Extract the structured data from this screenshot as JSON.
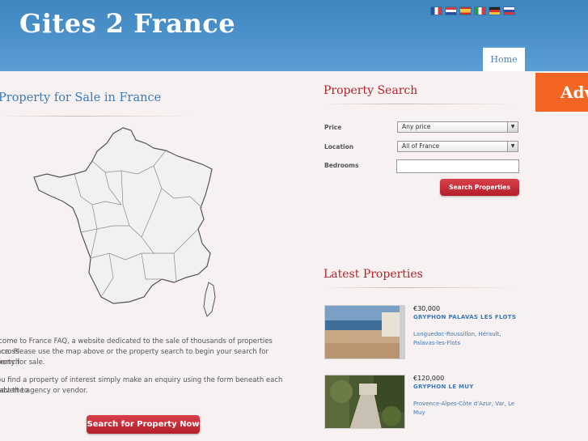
{
  "site": {
    "logo": "Gites 2 France"
  },
  "nav": {
    "home": "Home"
  },
  "banner": {
    "text": "Adv"
  },
  "flags": [
    "fr",
    "nl",
    "es",
    "it",
    "de",
    "ru"
  ],
  "main": {
    "title": "Property for Sale in France",
    "intro_1": "lcome to France FAQ, a website dedicated to the sale of thousands of properties across",
    "intro_2": "nce. Please use the map above or the property search to begin your search for French",
    "intro_3": "perty for sale.",
    "intro_4": "ou find a property of interest simply make an enquiry using the form beneath each advert to",
    "intro_5": "tact the agency or vendor.",
    "cta": "Search for Property Now"
  },
  "search": {
    "title": "Property Search",
    "price_label": "Price",
    "price_value": "Any price",
    "location_label": "Location",
    "location_value": "All of France",
    "bedrooms_label": "Bedrooms",
    "bedrooms_value": "",
    "submit": "Search Properties"
  },
  "latest": {
    "title": "Latest Properties",
    "items": [
      {
        "price": "€30,000",
        "name": "GRYPHON PALAVAS LES FLOTS",
        "location": "Languedoc-Roussillon, Hérault, Palavas-les-Flots"
      },
      {
        "price": "€120,000",
        "name": "GRYPHON LE MUY",
        "location": "Provence-Alpes-Côte d'Azur, Var, Le Muy"
      }
    ]
  },
  "colors": {
    "header": "#4e93cc",
    "accent_red": "#b0232a",
    "link_blue": "#3b79b8",
    "banner": "#f26522"
  }
}
